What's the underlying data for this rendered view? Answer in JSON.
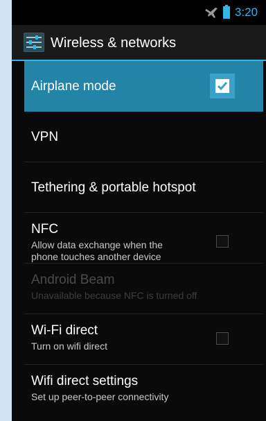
{
  "status_bar": {
    "time": "3:20",
    "airplane_icon": "airplane-icon",
    "battery_icon": "battery-icon"
  },
  "action_bar": {
    "title": "Wireless & networks",
    "icon": "settings-sliders-icon"
  },
  "colors": {
    "accent": "#33b5e5",
    "selected_row": "#2384a8",
    "checkbox_checked": "#3ba1c8",
    "background": "#0a0a0a"
  },
  "items": [
    {
      "title": "Airplane mode",
      "summary": "",
      "checkbox": true,
      "checked": true,
      "enabled": true,
      "selected": true
    },
    {
      "title": "VPN",
      "summary": "",
      "checkbox": false,
      "enabled": true
    },
    {
      "title": "Tethering & portable hotspot",
      "summary": "",
      "checkbox": false,
      "enabled": true
    },
    {
      "title": "NFC",
      "summary_line1": "Allow data exchange when the",
      "summary_line2": "phone touches another device",
      "checkbox": true,
      "checked": false,
      "enabled": true
    },
    {
      "title": "Android Beam",
      "summary": "Unavailable because NFC is turned off",
      "checkbox": false,
      "enabled": false
    },
    {
      "title": "Wi-Fi direct",
      "summary": "Turn on wifi direct",
      "checkbox": true,
      "checked": false,
      "enabled": true
    },
    {
      "title": "Wifi direct settings",
      "summary": "Set up peer-to-peer connectivity",
      "checkbox": false,
      "enabled": true
    }
  ]
}
